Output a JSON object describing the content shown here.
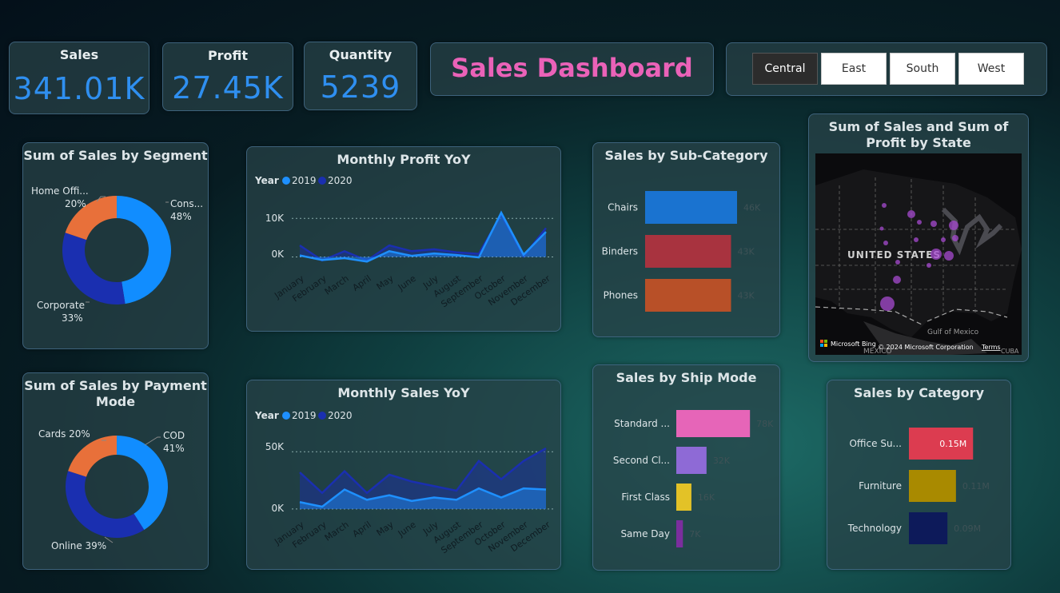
{
  "kpis": {
    "sales": {
      "label": "Sales",
      "value": "341.01K"
    },
    "profit": {
      "label": "Profit",
      "value": "27.45K"
    },
    "quantity": {
      "label": "Quantity",
      "value": "5239"
    }
  },
  "dashboard_title": "Sales Dashboard",
  "region_slicer": {
    "options": [
      "Central",
      "East",
      "South",
      "West"
    ],
    "selected": "Central"
  },
  "segment": {
    "title": "Sum of Sales by Segment",
    "labels": [
      {
        "name": "Cons...",
        "pct": "48%"
      },
      {
        "name": "Home Offi...",
        "pct": "20%"
      },
      {
        "name": "Corporate",
        "pct": "33%"
      }
    ]
  },
  "payment": {
    "title": "Sum of Sales by Payment Mode",
    "labels": [
      {
        "name": "COD",
        "pct": "41%"
      },
      {
        "name": "Cards 20%"
      },
      {
        "name": "Online 39%"
      }
    ]
  },
  "profit_yoy": {
    "title": "Monthly Profit YoY",
    "legend_title": "Year",
    "series_names": [
      "2019",
      "2020"
    ],
    "y_ticks": [
      "10K",
      "0K"
    ]
  },
  "sales_yoy": {
    "title": "Monthly Sales YoY",
    "legend_title": "Year",
    "series_names": [
      "2019",
      "2020"
    ],
    "y_ticks": [
      "50K",
      "0K"
    ]
  },
  "subcat": {
    "title": "Sales by Sub-Category",
    "data_labels": [
      "46K",
      "43K",
      "43K"
    ]
  },
  "shipmode": {
    "title": "Sales by Ship Mode",
    "data_labels": [
      "78K",
      "32K",
      "16K",
      "7K"
    ]
  },
  "category": {
    "title": "Sales by Category",
    "data_labels": [
      "0.15M",
      "0.11M",
      "0.09M"
    ]
  },
  "map": {
    "title": "Sum of Sales and Sum of Profit by State",
    "country_label": "UNITED STATES",
    "gulf_label": "Gulf of Mexico",
    "mexico_label": "MEXICO",
    "cuba_label": "CUBA",
    "bing_label": "Microsoft Bing",
    "copyright": "© 2024 Microsoft Corporation",
    "terms": "Terms"
  },
  "colors": {
    "accent_blue": "#2f8ff0",
    "title_pink": "#ea62b8",
    "series_2019": "#1e90ff",
    "series_2020": "#1a2fb0",
    "segment": [
      "#118dff",
      "#1a2fb0",
      "#e8703a"
    ],
    "payment": [
      "#118dff",
      "#1a2fb0",
      "#e8703a"
    ],
    "subcat": [
      "#1a73d0",
      "#a8333f",
      "#b85028"
    ],
    "shipmode": [
      "#e665b8",
      "#8e6ad6",
      "#e3c227",
      "#7b2e9e"
    ],
    "category": [
      "#dc3c50",
      "#a98a00",
      "#0d1a5a"
    ]
  },
  "chart_data": [
    {
      "type": "pie",
      "title": "Sum of Sales by Segment",
      "categories": [
        "Consumer",
        "Corporate",
        "Home Office"
      ],
      "values": [
        48,
        33,
        20
      ]
    },
    {
      "type": "pie",
      "title": "Sum of Sales by Payment Mode",
      "categories": [
        "COD",
        "Online",
        "Cards"
      ],
      "values": [
        41,
        39,
        20
      ]
    },
    {
      "type": "area",
      "title": "Monthly Profit YoY",
      "x": [
        "January",
        "February",
        "March",
        "April",
        "May",
        "June",
        "July",
        "August",
        "September",
        "October",
        "November",
        "December"
      ],
      "series": [
        {
          "name": "2019",
          "values": [
            400,
            -800,
            -300,
            -1200,
            1500,
            300,
            900,
            500,
            -100,
            11500,
            600,
            6500
          ]
        },
        {
          "name": "2020",
          "values": [
            3000,
            -900,
            1500,
            -900,
            3000,
            1500,
            2000,
            1200,
            800,
            11000,
            200,
            7500
          ]
        }
      ],
      "legend_title": "Year",
      "ylim": [
        -3000,
        14000
      ]
    },
    {
      "type": "area",
      "title": "Monthly Sales YoY",
      "x": [
        "January",
        "February",
        "March",
        "April",
        "May",
        "June",
        "July",
        "August",
        "September",
        "October",
        "November",
        "December"
      ],
      "series": [
        {
          "name": "2019",
          "values": [
            6000,
            2000,
            17000,
            8000,
            12000,
            7000,
            10000,
            8000,
            18000,
            10000,
            18000,
            17000
          ]
        },
        {
          "name": "2020",
          "values": [
            32000,
            14000,
            33000,
            14000,
            30000,
            24000,
            20000,
            16000,
            42000,
            26000,
            42000,
            53000
          ]
        }
      ],
      "legend_title": "Year",
      "ylim": [
        -5000,
        60000
      ]
    },
    {
      "type": "bar",
      "title": "Sales by Sub-Category",
      "categories": [
        "Chairs",
        "Binders",
        "Phones"
      ],
      "values": [
        46,
        43,
        43
      ],
      "unit": "K",
      "xlim": [
        0,
        70
      ]
    },
    {
      "type": "bar",
      "title": "Sales by Ship Mode",
      "categories": [
        "Standard ...",
        "Second Cl...",
        "First Class",
        "Same Day"
      ],
      "values": [
        78,
        32,
        16,
        7
      ],
      "unit": "K",
      "xlim": [
        0,
        110
      ]
    },
    {
      "type": "bar",
      "title": "Sales by Category",
      "categories": [
        "Office Su...",
        "Furniture",
        "Technology"
      ],
      "values": [
        0.15,
        0.11,
        0.09
      ],
      "unit": "M",
      "xlim": [
        0,
        0.2
      ]
    }
  ]
}
